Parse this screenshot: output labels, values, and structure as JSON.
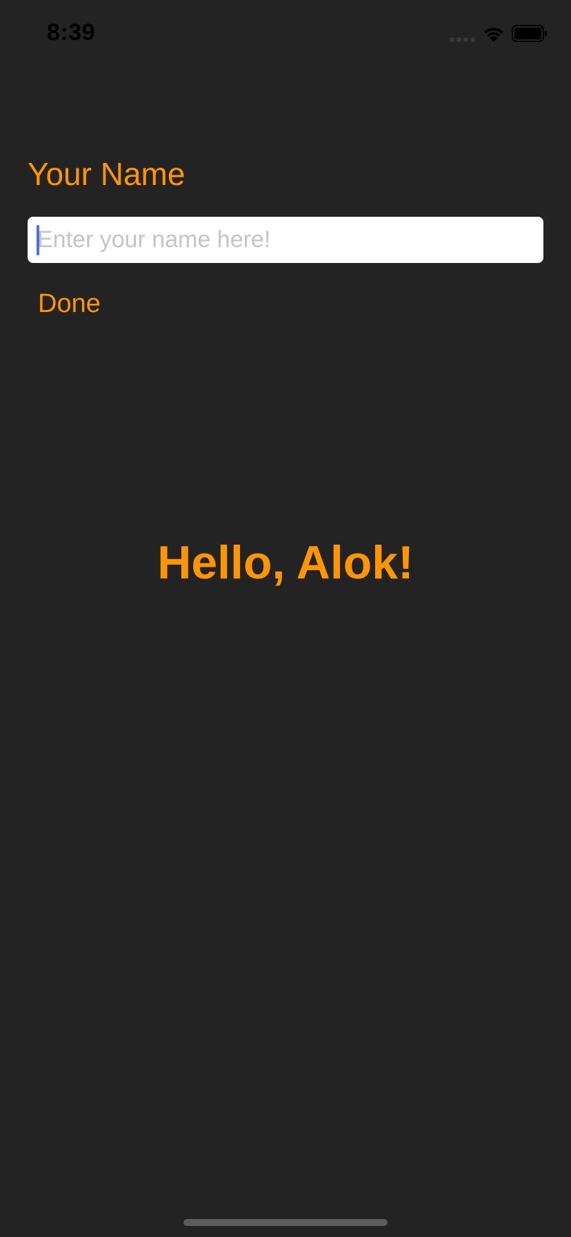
{
  "status_bar": {
    "time": "8:39",
    "signal_icon": "cellular-signal-icon",
    "wifi_icon": "wifi-icon",
    "battery_icon": "battery-icon"
  },
  "form": {
    "label": "Your Name",
    "input_value": "",
    "input_placeholder": "Enter your name here!",
    "done_label": "Done"
  },
  "greeting": "Hello, Alok!",
  "colors": {
    "background": "#232323",
    "accent": "#FF9500",
    "cursor": "#4A6CF7",
    "placeholder": "#C4C4C6",
    "input_background": "#FFFFFF"
  }
}
